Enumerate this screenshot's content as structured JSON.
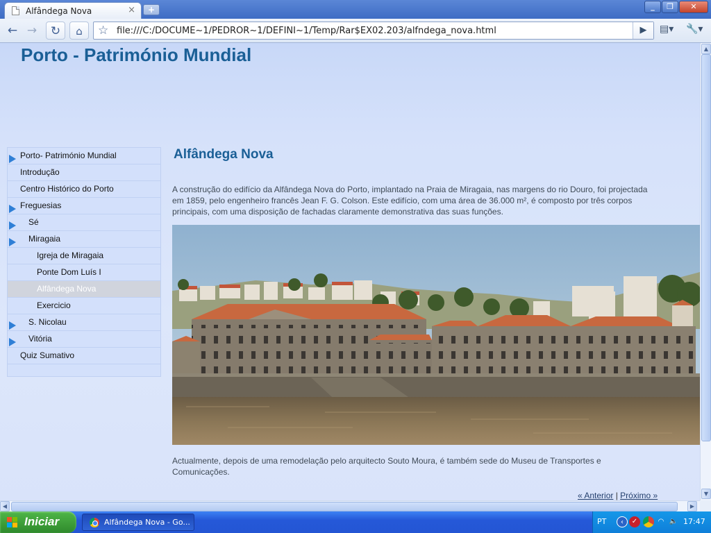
{
  "browser": {
    "tab_title": "Alfândega Nova",
    "tab_close": "×",
    "new_tab": "+",
    "url": "file:///C:/DOCUME~1/PEDROR~1/DEFINI~1/Temp/Rar$EX02.203/alfndega_nova.html",
    "window_buttons": {
      "minimize": "_",
      "maximize": "❐",
      "close": "✕"
    },
    "nav": {
      "back": "←",
      "forward": "→",
      "reload": "↻",
      "home": "⌂",
      "star": "☆",
      "go": "▶",
      "page_menu": "▤▾",
      "wrench_menu": "🔧▾"
    }
  },
  "page": {
    "site_title": "Porto - Património Mundial",
    "nav": [
      {
        "label": "Porto- Património Mundial",
        "arrow": true,
        "indent": 0,
        "active": false
      },
      {
        "label": "Introdução",
        "arrow": false,
        "indent": 0,
        "active": false
      },
      {
        "label": "Centro Histórico do Porto",
        "arrow": false,
        "indent": 0,
        "active": false
      },
      {
        "label": "Freguesias",
        "arrow": true,
        "indent": 0,
        "active": false
      },
      {
        "label": "Sé",
        "arrow": true,
        "indent": 1,
        "active": false
      },
      {
        "label": "Miragaia",
        "arrow": true,
        "indent": 1,
        "active": false
      },
      {
        "label": "Igreja de Miragaia",
        "arrow": false,
        "indent": 2,
        "active": false
      },
      {
        "label": "Ponte Dom Luís I",
        "arrow": false,
        "indent": 2,
        "active": false
      },
      {
        "label": "Alfândega Nova",
        "arrow": false,
        "indent": 2,
        "active": true
      },
      {
        "label": "Exercicio",
        "arrow": false,
        "indent": 2,
        "active": false
      },
      {
        "label": "S. Nicolau",
        "arrow": true,
        "indent": 1,
        "active": false
      },
      {
        "label": "Vitória",
        "arrow": true,
        "indent": 1,
        "active": false
      },
      {
        "label": "Quiz Sumativo",
        "arrow": false,
        "indent": 0,
        "active": false
      }
    ],
    "content_title": "Alfândega Nova",
    "paragraph1": "A construção do edifício da Alfândega Nova do Porto, implantado na Praia de Miragaia, nas margens do rio Douro, foi projectada em 1859, pelo engenheiro francês Jean F. G. Colson. Este edifício, com uma área de 36.000 m², é composto por três corpos principais, com uma disposição de fachadas claramente demonstrativa das suas funções.",
    "paragraph2": "Actualmente, depois de uma remodelação pelo arquitecto Souto Moura, é também sede do Museu de Transportes e Comunicações.",
    "pager": {
      "prev": "« Anterior",
      "separator": " | ",
      "next": "Próximo »"
    }
  },
  "scrollbars": {
    "up": "▲",
    "down": "▼",
    "left": "◀",
    "right": "▶"
  },
  "taskbar": {
    "start_label": "Iniciar",
    "task_label": "Alfândega Nova - Go...",
    "language": "PT",
    "clock": "17:47"
  }
}
